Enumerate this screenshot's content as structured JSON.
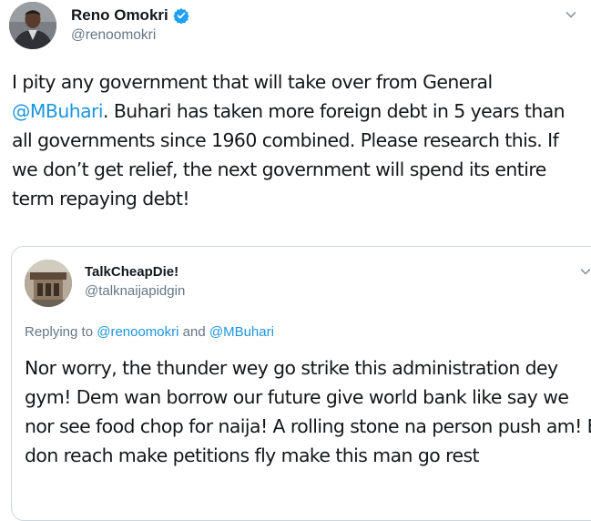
{
  "tweet": {
    "author_name": "Reno Omokri",
    "author_handle": "@renoomokri",
    "verified_icon": "verified-badge-icon",
    "menu_icon": "chevron-down-icon",
    "text_before_mention": "I pity any government that will take over from General ",
    "mention": "@MBuhari",
    "text_after_mention": ". Buhari has taken more foreign debt in 5 years than all governments since 1960 combined. Please research this. If we don’t get relief, the next government will spend its entire term repaying debt!"
  },
  "quoted_tweet": {
    "author_name": "TalkCheapDie!",
    "author_handle": "@talknaijapidgin",
    "menu_icon": "chevron-down-icon",
    "replying_prefix": "Replying to ",
    "replying_mention_1": "@renoomokri",
    "replying_joiner": " and ",
    "replying_mention_2": "@MBuhari",
    "text": "Nor worry, the thunder wey go strike this administration dey gym! Dem wan borrow our future give world bank like say we nor see food chop for naija! A rolling stone na person push am! E don reach make petitions fly make this man go rest"
  },
  "colors": {
    "text": "#14171a",
    "secondary": "#657786",
    "link": "#1b95e0",
    "verified": "#1da1f2",
    "border": "#ccd6dd"
  }
}
